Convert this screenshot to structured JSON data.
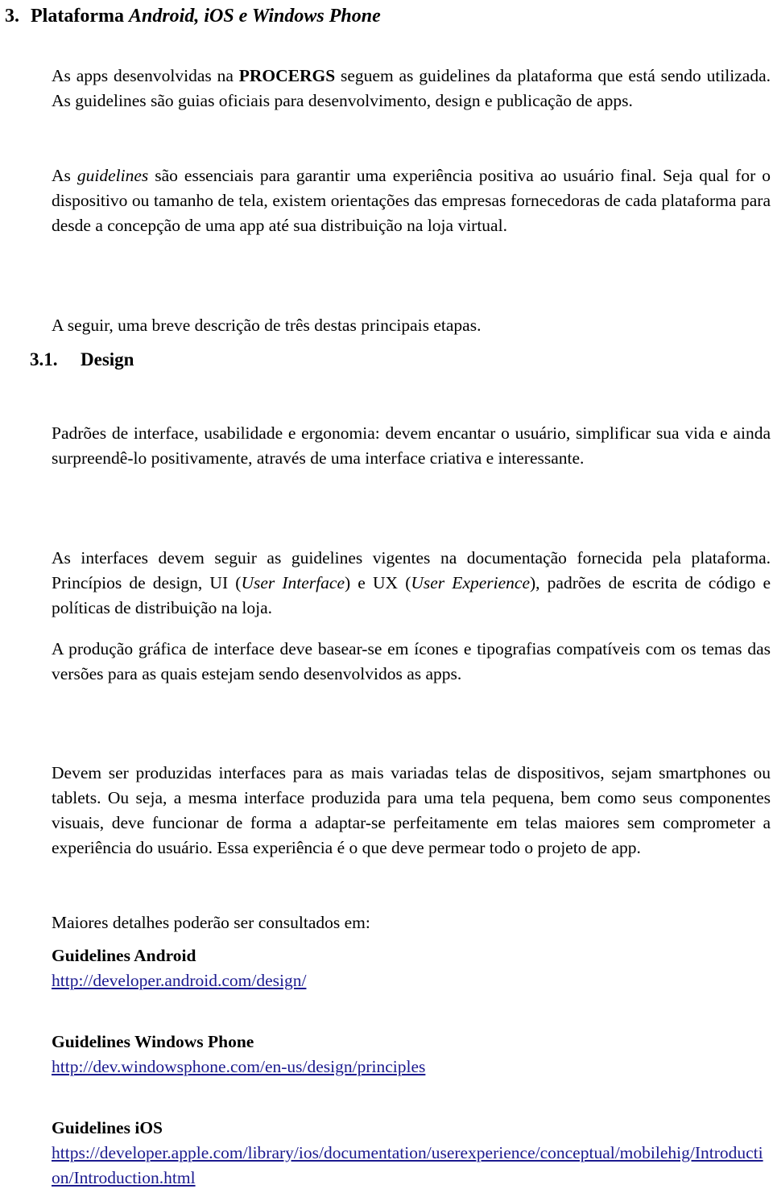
{
  "document": {
    "section_heading": {
      "number": "3.",
      "title_plain": "Plataforma ",
      "title_italic": "Android, iOS e Windows Phone"
    },
    "subsection_heading": {
      "number": "3.1.",
      "title": "Design"
    },
    "paragraphs": {
      "p1_a": "As apps desenvolvidas na ",
      "p1_bold": "PROCERGS",
      "p1_b": " seguem as guidelines da plataforma que está sendo utilizada. As guidelines são guias oficiais para desenvolvimento, design e publicação de apps.",
      "p2_a": "As ",
      "p2_ital": "guidelines",
      "p2_b": " são essenciais para garantir uma experiência positiva ao usuário final. Seja qual for o dispositivo ou tamanho de tela, existem orientações das empresas fornecedoras de cada plataforma para desde a concepção de uma app até sua distribuição na loja virtual.",
      "p3": "A seguir, uma breve descrição de três destas principais etapas.",
      "p4": "Padrões de interface, usabilidade e ergonomia: devem encantar o usuário, simplificar sua vida e ainda surpreendê-lo positivamente, através de uma interface criativa e interessante.",
      "p5_a": "As interfaces devem seguir as guidelines vigentes na documentação fornecida pela plataforma. Princípios de design, UI (",
      "p5_ital1": "User Interface",
      "p5_b": ") e UX (",
      "p5_ital2": "User Experience",
      "p5_c": "), padrões de escrita de código e políticas de distribuição na loja.",
      "p6": "A produção gráfica de interface deve basear-se em ícones e tipografias compatíveis com os temas das versões para as quais estejam sendo desenvolvidos as apps.",
      "p7": "Devem ser produzidas interfaces para as mais variadas telas de dispositivos, sejam smartphones ou tablets. Ou seja, a mesma interface produzida para uma tela pequena, bem como seus componentes visuais, deve funcionar de forma a adaptar-se perfeitamente em telas maiores sem comprometer a experiência do usuário. Essa experiência é o que deve permear todo o projeto de app.",
      "p8": "Maiores detalhes poderão ser consultados em:"
    },
    "links": {
      "android_heading": "Guidelines Android",
      "android_url": "http://developer.android.com/design/",
      "windows_phone_heading": "Guidelines Windows Phone",
      "windows_phone_url": "http://dev.windowsphone.com/en-us/design/principles",
      "ios_heading": "Guidelines iOS",
      "ios_url": "https://developer.apple.com/library/ios/documentation/userexperience/conceptual/mobilehig/Introduction/Introduction.html"
    },
    "colors": {
      "text": "#000000",
      "link": "#1b1a8f",
      "background": "#ffffff"
    }
  }
}
